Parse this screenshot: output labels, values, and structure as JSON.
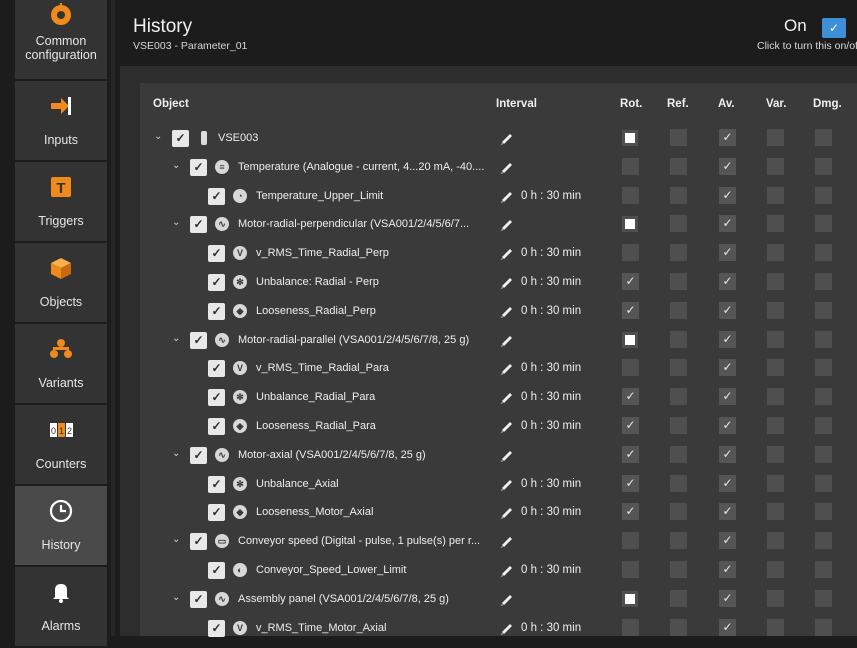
{
  "sidebar": {
    "items": [
      {
        "label": "Common\nconfiguration",
        "icon": "gear-wrench-icon",
        "active": false
      },
      {
        "label": "Inputs",
        "icon": "input-arrow-icon",
        "active": false
      },
      {
        "label": "Triggers",
        "icon": "trigger-t-icon",
        "active": false
      },
      {
        "label": "Objects",
        "icon": "cube-icon",
        "active": false
      },
      {
        "label": "Variants",
        "icon": "variants-icon",
        "active": false
      },
      {
        "label": "Counters",
        "icon": "counter-icon",
        "active": false
      },
      {
        "label": "History",
        "icon": "clock-icon",
        "active": true
      },
      {
        "label": "Alarms",
        "icon": "bell-icon",
        "active": false
      }
    ]
  },
  "header": {
    "title": "History",
    "subtitle": "VSE003 - Parameter_01",
    "on_label": "On",
    "on_hint": "Click to turn this on/off",
    "toggle_mark": "✓"
  },
  "columns": {
    "object": "Object",
    "interval": "Interval",
    "rot": "Rot.",
    "ref": "Ref.",
    "av": "Av.",
    "var": "Var.",
    "dmg": "Dmg."
  },
  "colors": {
    "accent": "#3d8fd6",
    "cell": "#4f4f4f",
    "background": "#1c1c1c"
  },
  "rows": [
    {
      "level": 0,
      "label": "VSE003",
      "icon": "device-icon",
      "interval": "",
      "rot": "white",
      "ref": "empty",
      "av": "check",
      "var": "empty",
      "dmg": "empty"
    },
    {
      "level": 1,
      "label": "Temperature (Analogue - current, 4...20 mA, -40....",
      "icon": "analog-input-icon",
      "interval": "",
      "rot": "empty",
      "ref": "empty",
      "av": "check",
      "var": "empty",
      "dmg": "empty"
    },
    {
      "level": 2,
      "label": "Temperature_Upper_Limit",
      "icon": "gauge-icon",
      "interval": "0 h : 30 min",
      "rot": "empty",
      "ref": "empty",
      "av": "check",
      "var": "empty",
      "dmg": "empty"
    },
    {
      "level": 1,
      "label": "Motor-radial-perpendicular (VSA001/2/4/5/6/7...",
      "icon": "sine-wave-icon",
      "interval": "",
      "rot": "white",
      "ref": "empty",
      "av": "check",
      "var": "empty",
      "dmg": "empty"
    },
    {
      "level": 2,
      "label": "v_RMS_Time_Radial_Perp",
      "icon": "vrms-clock-icon",
      "interval": "0 h : 30 min",
      "rot": "empty",
      "ref": "empty",
      "av": "check",
      "var": "empty",
      "dmg": "empty"
    },
    {
      "level": 2,
      "label": "Unbalance: Radial - Perp",
      "icon": "unbalance-icon",
      "interval": "0 h : 30 min",
      "rot": "check",
      "ref": "empty",
      "av": "check",
      "var": "empty",
      "dmg": "empty"
    },
    {
      "level": 2,
      "label": "Looseness_Radial_Perp",
      "icon": "looseness-cube-icon",
      "interval": "0 h : 30 min",
      "rot": "check",
      "ref": "empty",
      "av": "check",
      "var": "empty",
      "dmg": "empty"
    },
    {
      "level": 1,
      "label": "Motor-radial-parallel (VSA001/2/4/5/6/7/8, 25 g)",
      "icon": "sine-wave-icon",
      "interval": "",
      "rot": "white",
      "ref": "empty",
      "av": "check",
      "var": "empty",
      "dmg": "empty"
    },
    {
      "level": 2,
      "label": "v_RMS_Time_Radial_Para",
      "icon": "vrms-clock-icon",
      "interval": "0 h : 30 min",
      "rot": "empty",
      "ref": "empty",
      "av": "check",
      "var": "empty",
      "dmg": "empty"
    },
    {
      "level": 2,
      "label": "Unbalance_Radial_Para",
      "icon": "unbalance-icon",
      "interval": "0 h : 30 min",
      "rot": "check",
      "ref": "empty",
      "av": "check",
      "var": "empty",
      "dmg": "empty"
    },
    {
      "level": 2,
      "label": "Looseness_Radial_Para",
      "icon": "looseness-cube-icon",
      "interval": "0 h : 30 min",
      "rot": "check",
      "ref": "empty",
      "av": "check",
      "var": "empty",
      "dmg": "empty"
    },
    {
      "level": 1,
      "label": "Motor-axial (VSA001/2/4/5/6/7/8, 25 g)",
      "icon": "sine-wave-icon",
      "interval": "",
      "rot": "check",
      "ref": "empty",
      "av": "check",
      "var": "empty",
      "dmg": "empty"
    },
    {
      "level": 2,
      "label": "Unbalance_Axial",
      "icon": "unbalance-icon",
      "interval": "0 h : 30 min",
      "rot": "check",
      "ref": "empty",
      "av": "check",
      "var": "empty",
      "dmg": "empty"
    },
    {
      "level": 2,
      "label": "Looseness_Motor_Axial",
      "icon": "looseness-cube-icon",
      "interval": "0 h : 30 min",
      "rot": "check",
      "ref": "empty",
      "av": "check",
      "var": "empty",
      "dmg": "empty"
    },
    {
      "level": 1,
      "label": "Conveyor speed (Digital - pulse, 1 pulse(s) per r...",
      "icon": "digital-input-icon",
      "interval": "",
      "rot": "empty",
      "ref": "empty",
      "av": "check",
      "var": "empty",
      "dmg": "empty"
    },
    {
      "level": 2,
      "label": "Conveyor_Speed_Lower_Limit",
      "icon": "speed-limit-icon",
      "interval": "0 h : 30 min",
      "rot": "empty",
      "ref": "empty",
      "av": "check",
      "var": "empty",
      "dmg": "empty"
    },
    {
      "level": 1,
      "label": "Assembly panel (VSA001/2/4/5/6/7/8, 25 g)",
      "icon": "sine-wave-icon",
      "interval": "",
      "rot": "white",
      "ref": "empty",
      "av": "check",
      "var": "empty",
      "dmg": "empty"
    },
    {
      "level": 2,
      "label": "v_RMS_Time_Motor_Axial",
      "icon": "vrms-clock-icon",
      "interval": "0 h : 30 min",
      "rot": "empty",
      "ref": "empty",
      "av": "check",
      "var": "empty",
      "dmg": "empty"
    }
  ],
  "symbols": {
    "check": "✓",
    "chevron": "⌄"
  }
}
